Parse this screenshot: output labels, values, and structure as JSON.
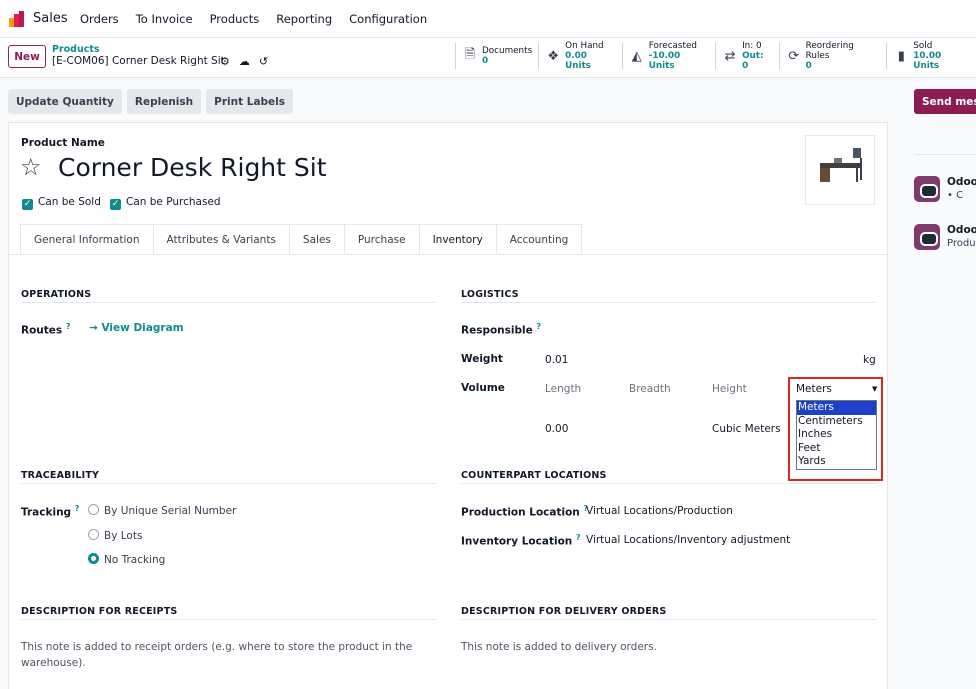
{
  "nav": {
    "app_name": "Sales",
    "menu": [
      "Orders",
      "To Invoice",
      "Products",
      "Reporting",
      "Configuration"
    ]
  },
  "control": {
    "new_label": "New",
    "breadcrumb_parent": "Products",
    "breadcrumb_current": "[E-COM06] Corner Desk Right Sit",
    "stats": [
      {
        "icon": "document-icon",
        "label": "Documents",
        "value": "0"
      },
      {
        "icon": "cubes-icon",
        "label": "On Hand",
        "value": "0.00 Units"
      },
      {
        "icon": "area-chart-icon",
        "label": "Forecasted",
        "value": "-10.00 Units"
      },
      {
        "icon": "exchange-icon",
        "label": "In: 0",
        "value": "Out: 0"
      },
      {
        "icon": "refresh-icon",
        "label": "Reordering Rules",
        "value": "0"
      },
      {
        "icon": "bar-chart-icon",
        "label": "Sold",
        "value": "10.00 Units"
      }
    ]
  },
  "actions": {
    "update_quantity": "Update Quantity",
    "replenish": "Replenish",
    "print_labels": "Print Labels",
    "send_message": "Send message"
  },
  "product": {
    "name_label": "Product Name",
    "name": "Corner Desk Right Sit",
    "can_be_sold": "Can be Sold",
    "can_be_purchased": "Can be Purchased"
  },
  "tabs": [
    "General Information",
    "Attributes & Variants",
    "Sales",
    "Purchase",
    "Inventory",
    "Accounting"
  ],
  "operations": {
    "title": "OPERATIONS",
    "routes_label": "Routes",
    "view_diagram": "→ View Diagram"
  },
  "logistics": {
    "title": "LOGISTICS",
    "responsible_label": "Responsible",
    "weight_label": "Weight",
    "weight_value": "0.01",
    "weight_unit": "kg",
    "volume_label": "Volume",
    "length": "Length",
    "breadth": "Breadth",
    "height": "Height",
    "volume_value": "0.00",
    "volume_unit": "Cubic Meters",
    "unit_selected": "Meters",
    "unit_options": [
      "Meters",
      "Centimeters",
      "Inches",
      "Feet",
      "Yards"
    ]
  },
  "traceability": {
    "title": "TRACEABILITY",
    "tracking_label": "Tracking",
    "options": [
      "By Unique Serial Number",
      "By Lots",
      "No Tracking"
    ]
  },
  "counterpart": {
    "title": "COUNTERPART LOCATIONS",
    "production_label": "Production Location",
    "production_value": "Virtual Locations/Production",
    "inventory_label": "Inventory Location",
    "inventory_value": "Virtual Locations/Inventory adjustment"
  },
  "desc_receipts": {
    "title": "DESCRIPTION FOR RECEIPTS",
    "line1": "This note is added to receipt orders (e.g. where to store the product in the",
    "line2": "warehouse)."
  },
  "desc_delivery": {
    "title": "DESCRIPTION FOR DELIVERY ORDERS",
    "text": "This note is added to delivery orders."
  },
  "chatter": {
    "item1_name": "Odoo",
    "item1_line": "• C",
    "item2_name": "Odoo",
    "item2_line": "Produ"
  }
}
